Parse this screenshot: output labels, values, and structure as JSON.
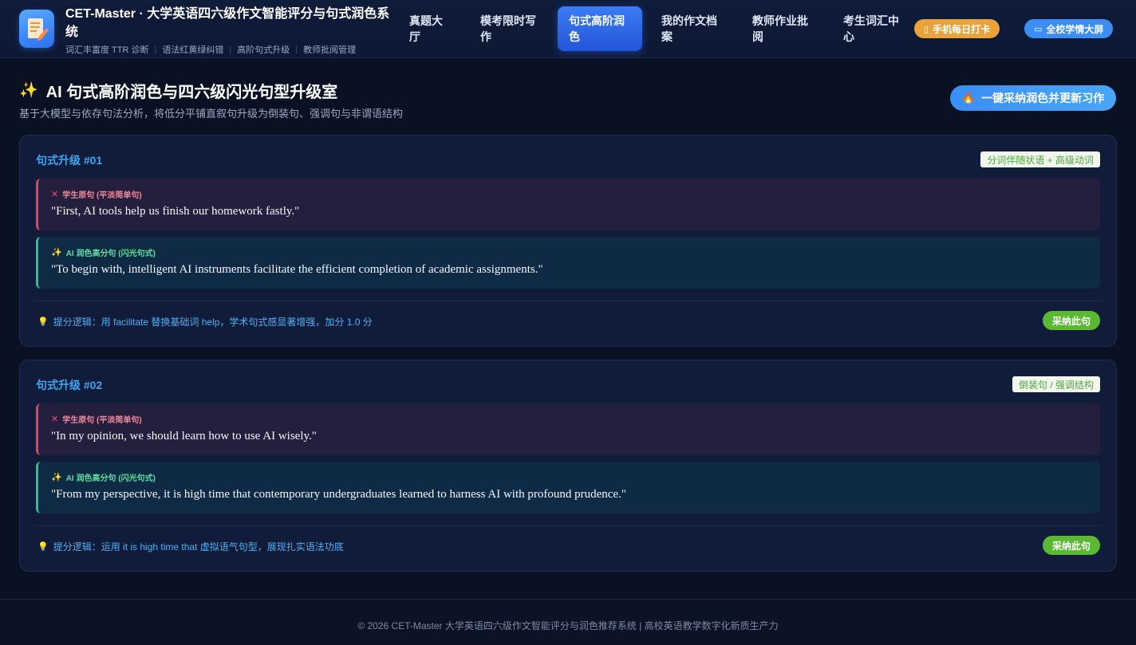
{
  "header": {
    "brand_title": "CET-Master · 大学英语四六级作文智能评分与句式润色系统",
    "tags": [
      "词汇丰富度 TTR 诊断",
      "语法红黄绿纠错",
      "高阶句式升级",
      "教师批阅管理"
    ],
    "nav": [
      {
        "label": "真题大厅",
        "active": false
      },
      {
        "label": "模考限时写作",
        "active": false
      },
      {
        "label": "句式高阶润色",
        "active": true
      },
      {
        "label": "我的作文档案",
        "active": false
      },
      {
        "label": "教师作业批阅",
        "active": false
      },
      {
        "label": "考生词汇中心",
        "active": false
      }
    ],
    "pill_checkin": "手机每日打卡",
    "pill_dashboard": "全校学情大屏"
  },
  "page": {
    "title": "AI 句式高阶润色与四六级闪光句型升级室",
    "subtitle": "基于大模型与依存句法分析，将低分平铺直叙句升级为倒装句、强调句与非谓语结构",
    "apply_all_label": "一键采纳润色并更新习作"
  },
  "cards": [
    {
      "title": "句式升级 #01",
      "tag": "分词伴随状语 + 高级动词",
      "original_label": "学生原句 (平淡简单句)",
      "original_text": "\"First, AI tools help us finish our homework fastly.\"",
      "polished_label": "AI 润色高分句 (闪光句式)",
      "polished_text": "\"To begin with, intelligent AI instruments facilitate the efficient completion of academic assignments.\"",
      "logic": "提分逻辑：用 facilitate 替换基础词 help，学术句式感显著增强，加分 1.0 分",
      "adopt_label": "采纳此句"
    },
    {
      "title": "句式升级 #02",
      "tag": "倒装句 / 强调结构",
      "original_label": "学生原句 (平淡简单句)",
      "original_text": "\"In my opinion, we should learn how to use AI wisely.\"",
      "polished_label": "AI 润色高分句 (闪光句式)",
      "polished_text": "\"From my perspective, it is high time that contemporary undergraduates learned to harness AI with profound prudence.\"",
      "logic": "提分逻辑：运用 it is high time that 虚拟语气句型，展现扎实语法功底",
      "adopt_label": "采纳此句"
    }
  ],
  "footer": {
    "text": "© 2026 CET-Master 大学英语四六级作文智能评分与润色推荐系统 | 高校英语教学数字化新质生产力"
  },
  "icons": {
    "logo": "document-pen-icon",
    "checkin": "phone-icon",
    "dashboard": "monitor-icon",
    "title": "sparkles-icon",
    "apply_all": "fire-icon",
    "original": "cross-icon",
    "polished": "sparkles-icon",
    "logic": "lightbulb-icon"
  },
  "colors": {
    "accent": "#2d6ff0",
    "original_border": "#e0455a",
    "polished_border": "#2bbf8a",
    "adopt": "#5bb832"
  }
}
